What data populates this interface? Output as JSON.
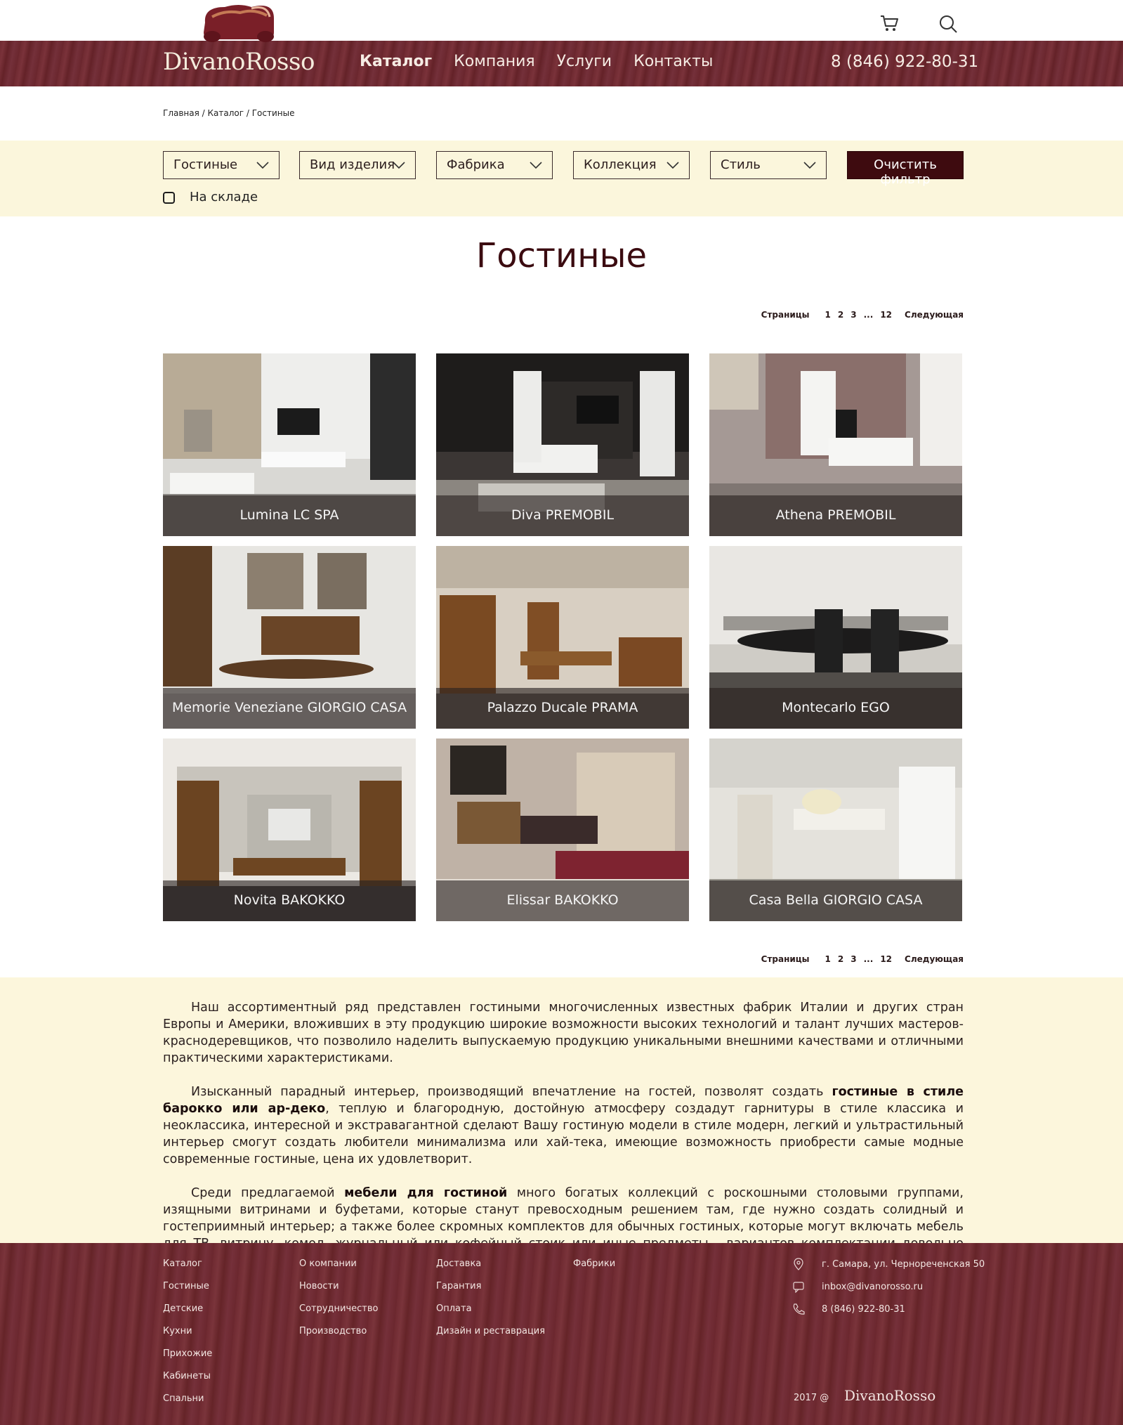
{
  "header": {
    "logo_text": "DivanoRosso",
    "nav": [
      "Каталог",
      "Компания",
      "Услуги",
      "Контакты"
    ],
    "active_nav": "Каталог",
    "phone": "8 (846) 922-80-31",
    "icons": [
      "cart-icon",
      "search-icon"
    ]
  },
  "breadcrumb": {
    "home": "Главная",
    "sep": " / ",
    "catalog": "Каталог",
    "current": "Гостиные"
  },
  "filters": {
    "selects": [
      "Гостиные",
      "Вид изделия",
      "Фабрика",
      "Коллекция",
      "Стиль"
    ],
    "clear_label": "Очистить фильтр",
    "in_stock_label": "На складе",
    "in_stock_checked": false
  },
  "page_title": "Гостиные",
  "pagination": {
    "label": "Страницы",
    "pages": [
      "1",
      "2",
      "3"
    ],
    "dots": "...",
    "last": "12",
    "next": "Следующая"
  },
  "products": [
    "Lumina LC SPA",
    "Diva PREMOBIL",
    "Athena  PREMOBIL",
    "Memorie Veneziane GIORGIO CASA",
    "Palazzo Ducale PRAMA",
    "Montecarlo EGO",
    "Novita BAKOKKO",
    "Elissar BAKOKKO",
    "Casa Bella GIORGIO CASA"
  ],
  "description": {
    "p1": "Наш ассортиментный ряд представлен гостиными многочисленных известных фабрик Италии и других стран Европы и Америки, вложивших в эту продукцию широкие возможности высоких технологий и талант лучших мастеров-краснодеревщиков, что позволило наделить выпускаемую продукцию уникальными внешними качествами и отличными практическими характеристиками.",
    "p2_a": "Изысканный парадный интерьер, производящий впечатление на гостей, позволят создать ",
    "p2_b": "гостиные в стиле барокко или ар-деко",
    "p2_c": ", теплую и благородную, достойную атмосферу создадут гарнитуры в стиле классика и неоклассика, интересной и экстравагантной сделают Вашу гостиную модели в стиле модерн, легкий и ультрастильный интерьер смогут создать любители минимализма или хай-тека, имеющие возможность приобрести самые модные современные гостиные, цена их удовлетворит.",
    "p3_a": "Среди предлагаемой ",
    "p3_b": "мебели для гостиной",
    "p3_c": " много богатых коллекций с роскошными столовыми группами, изящными витринами и буфетами, которые станут превосходным решением там, где нужно создать солидный и гостеприимный интерьер; а также более скромных комплектов для обычных гостиных, которые могут включать мебель для ТВ, витрину, комод, журнальный или кофейный стоик или иные предметы - вариантов комплектации довольно много."
  },
  "footer": {
    "col1": [
      "Каталог",
      "Гостиные",
      "Детские",
      "Кухни",
      "Прихожие",
      "Кабинеты",
      "Спальни"
    ],
    "col2": [
      "О компании",
      "Новости",
      "Сотрудничество",
      "Производство"
    ],
    "col3": [
      "Доставка",
      "Гарантия",
      "Оплата",
      "Дизайн и реставрация"
    ],
    "col4": [
      "Фабрики"
    ],
    "address": "г. Самара, ул. Чернореченская 50",
    "email": "inbox@divanorosso.ru",
    "phone": "8 (846) 922-80-31",
    "copyright": "2017 @",
    "logo_text": "DivanoRosso"
  },
  "colors": {
    "brand_dark": "#3e0b0f",
    "wood": "#6f2a31",
    "cream": "#fbf6dc"
  }
}
